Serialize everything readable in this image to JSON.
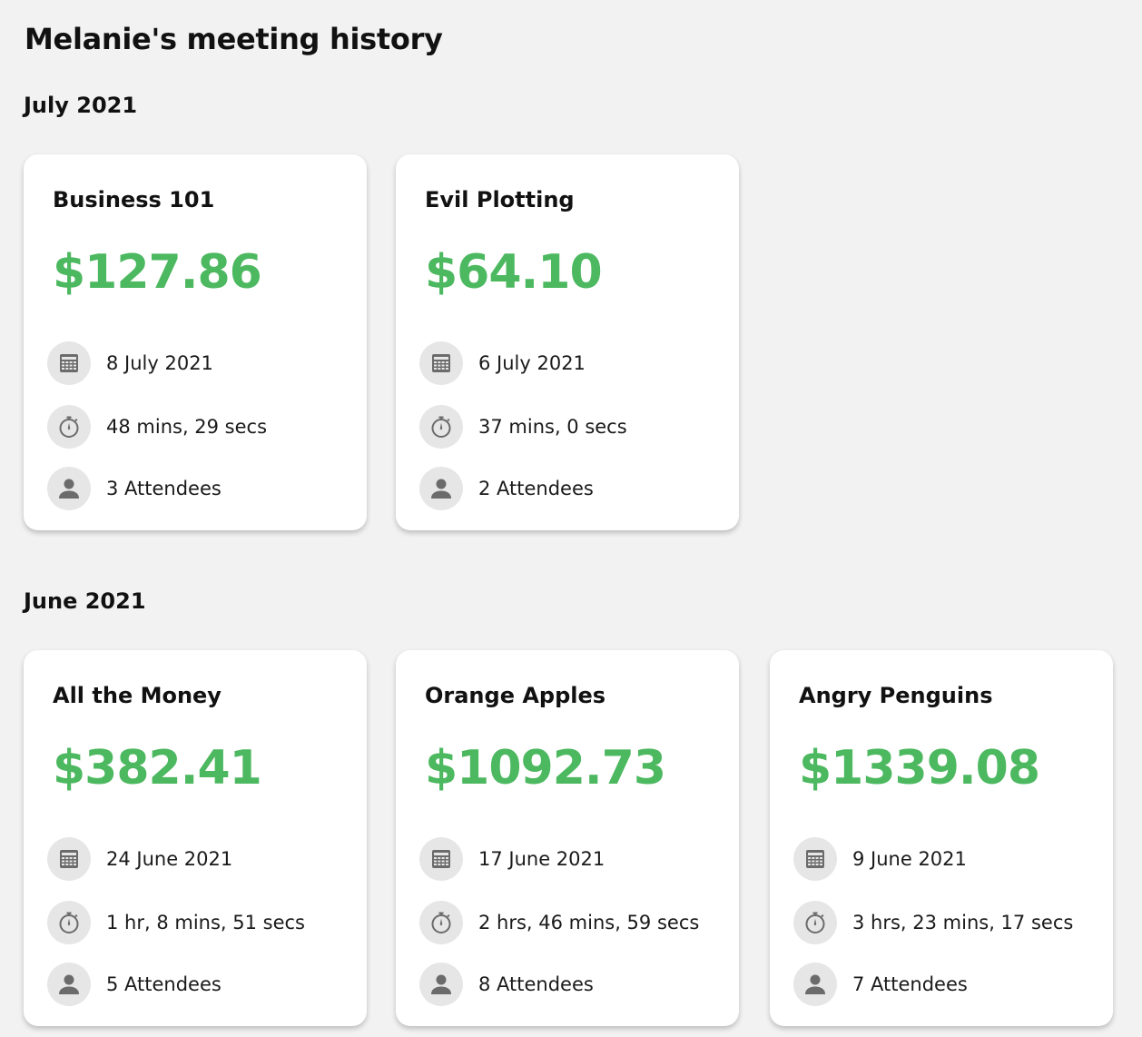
{
  "page_title": "Melanie's meeting history",
  "icons": {
    "date": "calendar-icon",
    "duration": "stopwatch-icon",
    "attendees": "person-icon"
  },
  "colors": {
    "cost": "#4cb85f",
    "background": "#f2f2f2",
    "card": "#ffffff",
    "icon": "#6b6b6b"
  },
  "sections": [
    {
      "heading": "July 2021",
      "meetings": [
        {
          "title": "Business 101",
          "cost": "$127.86",
          "date": "8 July 2021",
          "duration": "48 mins, 29 secs",
          "attendees": "3 Attendees"
        },
        {
          "title": "Evil Plotting",
          "cost": "$64.10",
          "date": "6 July 2021",
          "duration": "37 mins, 0 secs",
          "attendees": "2 Attendees"
        }
      ]
    },
    {
      "heading": "June 2021",
      "meetings": [
        {
          "title": "All the Money",
          "cost": "$382.41",
          "date": "24 June 2021",
          "duration": "1 hr, 8 mins, 51 secs",
          "attendees": "5 Attendees"
        },
        {
          "title": "Orange Apples",
          "cost": "$1092.73",
          "date": "17 June 2021",
          "duration": "2 hrs, 46 mins, 59 secs",
          "attendees": "8 Attendees"
        },
        {
          "title": "Angry Penguins",
          "cost": "$1339.08",
          "date": "9 June 2021",
          "duration": "3 hrs, 23 mins, 17 secs",
          "attendees": "7 Attendees"
        }
      ]
    }
  ]
}
